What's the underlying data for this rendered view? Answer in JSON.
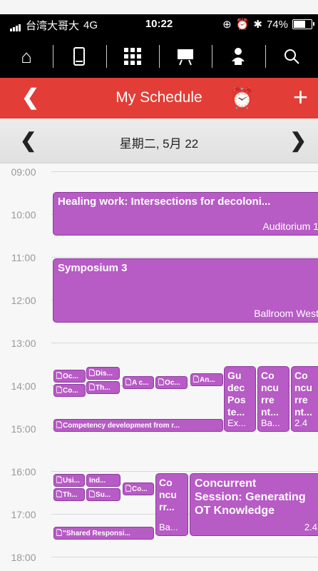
{
  "status": {
    "carrier": "台湾大哥大",
    "network": "4G",
    "time": "10:22",
    "battery": "74%",
    "battery_level": 0.74
  },
  "nav": {
    "icons": [
      "home-icon",
      "phone-icon",
      "grid-icon",
      "presentation-icon",
      "speaker-icon",
      "search-icon"
    ]
  },
  "header": {
    "title": "My Schedule"
  },
  "datebar": {
    "date": "星期二, 5月 22"
  },
  "hours": [
    "09:00",
    "10:00",
    "11:00",
    "12:00",
    "13:00",
    "14:00",
    "15:00",
    "16:00",
    "17:00",
    "18:00"
  ],
  "events": {
    "healing": {
      "title": "Healing work: Intersections for decoloni...",
      "location": "Auditorium 1"
    },
    "symposium": {
      "title": "Symposium 3",
      "location": "Ballroom West"
    },
    "chips_1400": [
      "Oc...",
      "Dis...",
      "Co...",
      "Th...",
      "A c...",
      "Oc...",
      "An..."
    ],
    "competency": "Competency development from r...",
    "cols_1400": [
      {
        "lines": [
          "Gu",
          "dec",
          "Pos",
          "te..."
        ],
        "foot": "Ex..."
      },
      {
        "lines": [
          "Co",
          "ncu",
          "rre",
          "nt..."
        ],
        "foot": "Ba..."
      },
      {
        "lines": [
          "Co",
          "ncu",
          "rre",
          "nt..."
        ],
        "foot": "2.4"
      }
    ],
    "chips_1600": [
      "Usi...",
      "Ind...",
      "Th...",
      "Su...",
      "Co..."
    ],
    "shared": "\"Shared Responsi...",
    "col_1600": {
      "lines": [
        "Co",
        "ncu",
        "rr..."
      ],
      "foot": "Ba..."
    },
    "concurrent": {
      "lines": [
        "Concurrent",
        "Session: Generating",
        "OT Knowledge"
      ],
      "foot": "2.4"
    }
  }
}
